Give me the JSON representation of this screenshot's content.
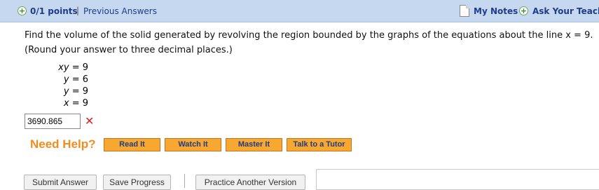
{
  "header": {
    "points": "0/1 points",
    "separator": "|",
    "previous_answers": "Previous Answers",
    "my_notes": "My Notes",
    "ask_teacher": "Ask Your Teacher"
  },
  "question": {
    "text": "Find the volume of the solid generated by revolving the region bounded by the graphs of the equations about the line x = 9. (Round your answer to three decimal places.)",
    "equations": [
      {
        "lhs": "xy",
        "rhs": "= 9"
      },
      {
        "lhs": "y",
        "rhs": "= 6"
      },
      {
        "lhs": "y",
        "rhs": "= 9"
      },
      {
        "lhs": "x",
        "rhs": "= 9"
      }
    ]
  },
  "answer": {
    "value": "3690.865",
    "status_icon": "incorrect-x-icon"
  },
  "help": {
    "label": "Need Help?",
    "buttons": [
      "Read It",
      "Watch It",
      "Master It",
      "Talk to a Tutor"
    ]
  },
  "actions": {
    "submit": "Submit Answer",
    "save": "Save Progress",
    "practice": "Practice Another Version"
  },
  "colors": {
    "header_bg": "#c6d8f0",
    "link": "#1f3c88",
    "help_orange": "#f28c1c",
    "button_orange": "#f7a830",
    "error_red": "#e02020"
  }
}
